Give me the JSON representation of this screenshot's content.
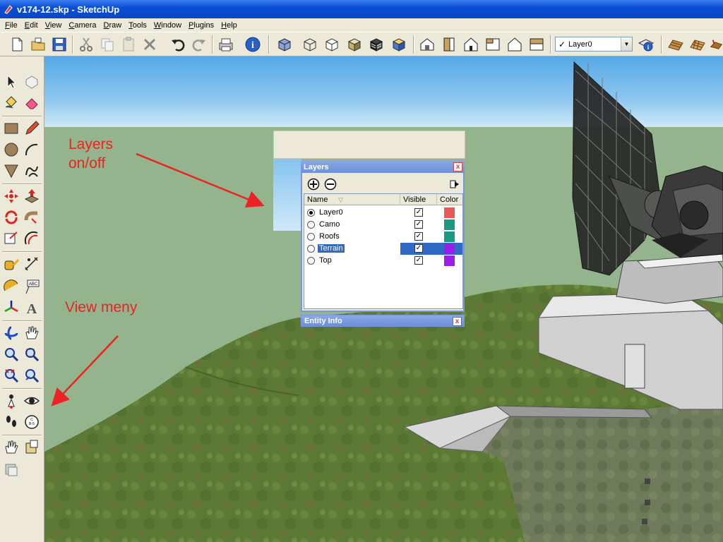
{
  "window": {
    "title": "v174-12.skp - SketchUp"
  },
  "menu": [
    "File",
    "Edit",
    "View",
    "Camera",
    "Draw",
    "Tools",
    "Window",
    "Plugins",
    "Help"
  ],
  "toolbar": {
    "layer_selected": "Layer0",
    "layer_checkmark": "✓"
  },
  "layers_dialog": {
    "title": "Layers",
    "close_glyph": "x",
    "columns": {
      "name": "Name",
      "visible": "Visible",
      "color": "Color"
    },
    "rows": [
      {
        "name": "Layer0",
        "active": true,
        "visible": true,
        "color": "#e85a5a"
      },
      {
        "name": "Camo",
        "active": false,
        "visible": true,
        "color": "#1a9a80"
      },
      {
        "name": "Roofs",
        "active": false,
        "visible": true,
        "color": "#1a9a80"
      },
      {
        "name": "Terrain",
        "active": false,
        "visible": true,
        "color": "#9b1ee8",
        "selected": true
      },
      {
        "name": "Top",
        "active": false,
        "visible": true,
        "color": "#9b1ee8"
      }
    ]
  },
  "entity_info": {
    "title": "Entity Info",
    "close_glyph": "x"
  },
  "annotations": {
    "layers_line1": "Layers",
    "layers_line2": "on/off",
    "view_menu": "View meny"
  },
  "colors": {
    "accent_title": "#0a4fd6",
    "annotation": "#ee2222",
    "selection": "#316ac5"
  }
}
